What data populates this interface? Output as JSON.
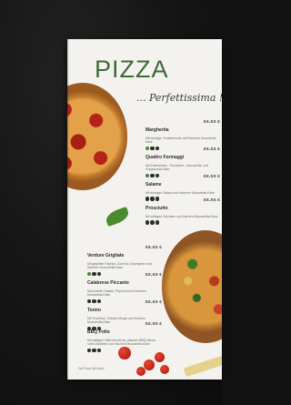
{
  "menu": {
    "title": "PIZZA",
    "subtitle": "... Perfettissima !",
    "footer_note": "Vali Pizza Vali Marlo",
    "right_items": [
      {
        "name": "Margherita",
        "price": "XX.XX €",
        "desc": "Mit würziger Tomatensoße und frischem Mozzarella-Käse",
        "tags": [
          "green",
          "dark",
          "dark"
        ]
      },
      {
        "name": "Quattro Formaggi",
        "price": "XX.XX €",
        "desc": "Mit Emmentaler-, Provolone-, Mozzarella- und Gorgonzola-Käse",
        "tags": [
          "green",
          "dark",
          "dark"
        ]
      },
      {
        "name": "Salame",
        "price": "XX.XX €",
        "desc": "Mit würziger Salami und frischem Mozzarella-Käse",
        "tags": [
          "dark",
          "dark",
          "dark"
        ]
      },
      {
        "name": "Prosciutto",
        "price": "XX.XX €",
        "desc": "Mit saftigem Schinken und frischem Mozzarella-Käse",
        "tags": [
          "dark",
          "dark",
          "dark"
        ]
      }
    ],
    "left_items": [
      {
        "name": "Verdure Grigliate",
        "price": "XX.XX €",
        "desc": "Mit gegrillter Paprika, Zucchini, Auberginen und frischem Mozzarella-Käse",
        "tags": [
          "green",
          "dark",
          "dark"
        ]
      },
      {
        "name": "Calabrese Piccante",
        "price": "XX.XX €",
        "desc": "Mit scharfer Salami, Peperoni und frischem Mozzarella-Käse",
        "tags": [
          "dark",
          "dark",
          "dark"
        ]
      },
      {
        "name": "Tonno",
        "price": "XX.XX €",
        "desc": "Mit Thunfisch, Zwiebel-Ringe und frischem Mozzarella-Käse",
        "tags": [
          "dark",
          "dark",
          "dark"
        ]
      },
      {
        "name": "BBQ Pollo",
        "price": "XX.XX €",
        "desc": "Mit saftigem Hähnchenbrust, pikanter BBQ-Sauce, roten Zwiebeln und frischem Mozzarella-Käse",
        "tags": [
          "dark",
          "dark",
          "dark"
        ]
      }
    ]
  },
  "colors": {
    "background": "#121212",
    "paper": "#f3f2ee",
    "title_green": "#3f6b37",
    "tag_green": "#3f8a34"
  }
}
